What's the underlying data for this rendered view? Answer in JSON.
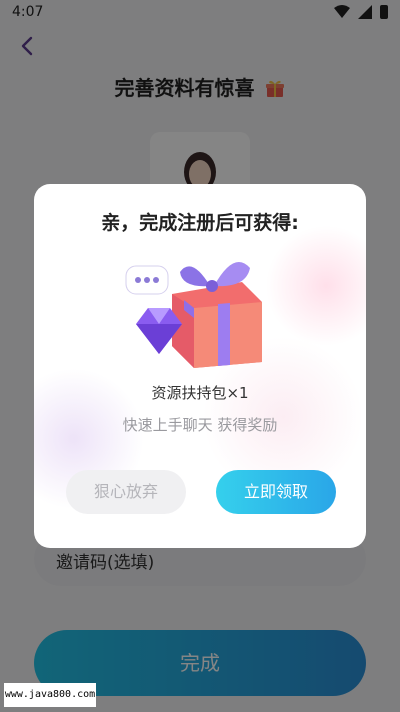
{
  "status_bar": {
    "time": "4:07"
  },
  "page": {
    "title": "完善资料有惊喜",
    "invite_placeholder": "邀请码(选填)",
    "finish_label": "完成"
  },
  "modal": {
    "title": "亲，完成注册后可获得:",
    "reward_name": "资源扶持包×1",
    "reward_desc": "快速上手聊天 获得奖励",
    "giveup_label": "狠心放弃",
    "claim_label": "立即领取"
  },
  "watermark": {
    "text": "www.java800.com"
  },
  "colors": {
    "accent_start": "#35d0ec",
    "accent_end": "#2aa6e8",
    "back_arrow": "#5b3a8c"
  }
}
